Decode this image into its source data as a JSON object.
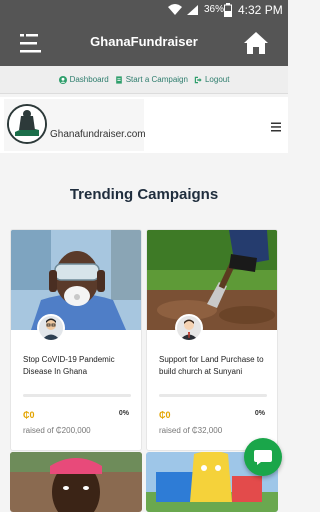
{
  "status_bar": {
    "battery_percent": "36%",
    "time": "4:32 PM"
  },
  "app_bar": {
    "title": "GhanaFundraiser"
  },
  "top_links": [
    {
      "label": "Dashboard",
      "icon": "user-icon"
    },
    {
      "label": "Start a Campaign",
      "icon": "document-icon"
    },
    {
      "label": "Logout",
      "icon": "logout-icon"
    }
  ],
  "site_header": {
    "logo_text": "Ghanafundraiser.com"
  },
  "trending": {
    "title": "Trending Campaigns",
    "campaigns": [
      {
        "title": "Stop CoVID-19 Pandemic Disease In Ghana",
        "amount": "₵0",
        "percent": "0%",
        "progress": 0,
        "raised": "raised of ₵200,000"
      },
      {
        "title": "Support for Land Purchase to build church at Sunyani",
        "amount": "₵0",
        "percent": "0%",
        "progress": 0,
        "raised": "raised of ₵32,000"
      }
    ]
  },
  "colors": {
    "app_bar": "#555555",
    "link_green": "#2e7d6d",
    "accent_gold": "#e3a400",
    "fab_green": "#1aa64a"
  }
}
